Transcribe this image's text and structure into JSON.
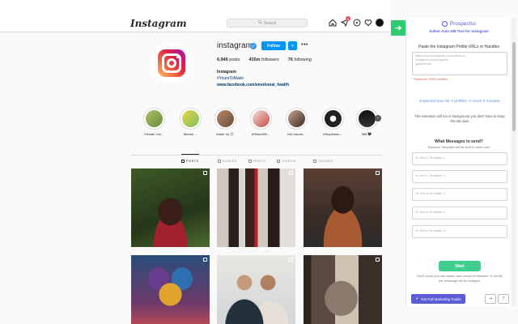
{
  "instagram": {
    "logo": "Instagram",
    "search_placeholder": "Search",
    "notification_count": "6",
    "profile": {
      "username": "instagram",
      "follow_label": "Follow",
      "more_label": "•••",
      "stats": [
        {
          "value": "6,946",
          "label": "posts"
        },
        {
          "value": "435m",
          "label": "followers"
        },
        {
          "value": "76",
          "label": "following"
        }
      ],
      "bio_name": "Instagram",
      "bio_hashtag": "#YoursToMake",
      "bio_link": "www.facebook.com/emotional_health"
    },
    "highlights": [
      {
        "label": "Climate Jus...",
        "color": "#a7c36a"
      },
      {
        "label": "Mental ...",
        "color": "#e8d64a"
      },
      {
        "label": "Made Us 😊",
        "color": "#b88a6a"
      },
      {
        "label": "#ShareWit...",
        "color": "#d9c3b5"
      },
      {
        "label": "Get Vaccin...",
        "color": "#c9a38f"
      },
      {
        "label": "#StopAsian...",
        "color": "#222222"
      },
      {
        "label": "365 🖤",
        "color": "#111111"
      }
    ],
    "tabs": [
      {
        "label": "POSTS",
        "icon": "grid-icon"
      },
      {
        "label": "GUIDES",
        "icon": "guide-icon"
      },
      {
        "label": "REELS",
        "icon": "reels-icon"
      },
      {
        "label": "VIDEOS",
        "icon": "video-icon"
      },
      {
        "label": "TAGGED",
        "icon": "tag-icon"
      }
    ]
  },
  "prospectss": {
    "brand": "Prospectss",
    "tagline": "Safest Auto DM Tool for Instagram",
    "urls_title": "Paste the Instagram Profile URLs or Handles",
    "urls_placeholder": "https://www.instagram.com/cristiano/\ninstagram.com/jlo/gisele\ngarybvenuk",
    "max_note": "* Maximum 20000 profiles",
    "expected_time": "Expected time for 0 profiles: 0 hours 0 minutes",
    "background_note": "The extension will run in background you don't have to keep the tab open",
    "messages_title": "What Messages to send?",
    "messages_subtitle": "Random Template will be sent to each user",
    "templates": [
      "Hi, this is Template 1",
      "Hi, this is Template 2",
      "Hi, this is Template 3",
      "Hi, this is Template 4",
      "Hi, this is Template 5"
    ],
    "start_label": "Start",
    "footer_note": "Don't worry you can pause and cancel in between. 5 credits per message will be charged.",
    "full_tools_label": "Get Full Marketing Toolkit"
  }
}
